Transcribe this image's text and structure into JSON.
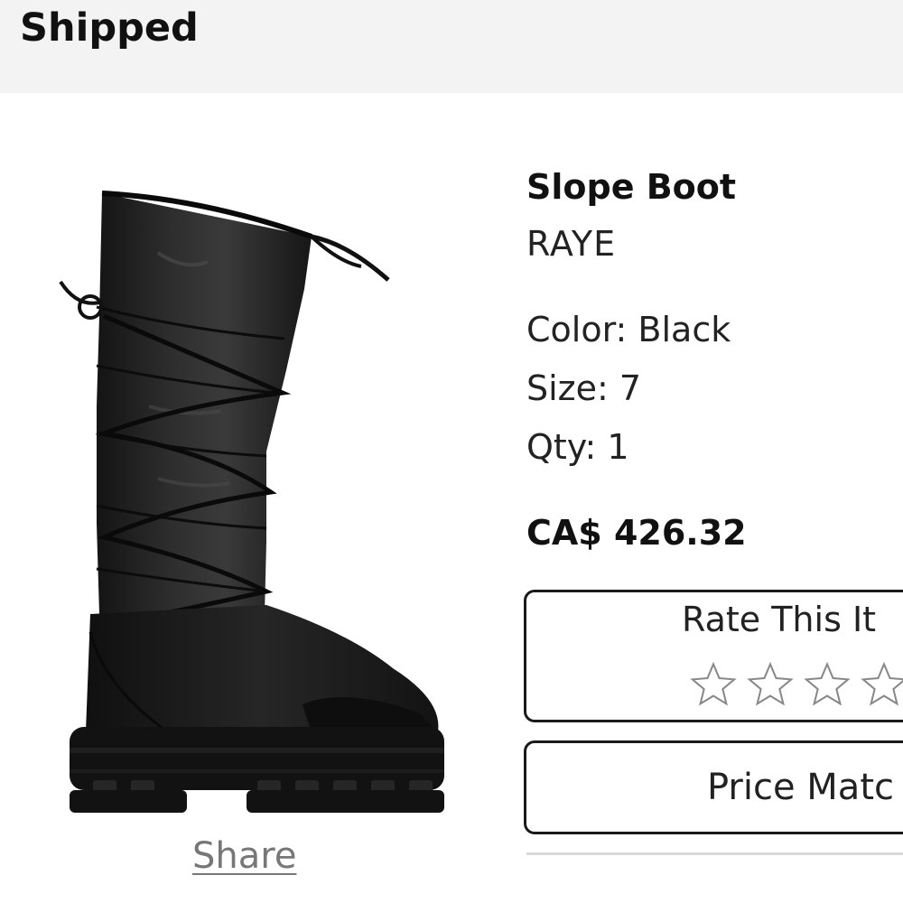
{
  "order": {
    "status": "Shipped"
  },
  "product": {
    "name": "Slope Boot",
    "brand": "RAYE",
    "color_line": "Color: Black",
    "size_line": "Size: 7",
    "qty_line": "Qty: 1",
    "price": "CA$ 426.32",
    "image_icon": "boot-product-photo"
  },
  "actions": {
    "share_label": "Share",
    "rate_title": "Rate This It",
    "rating": {
      "value": 0,
      "max": 5,
      "icon": "star-outline-icon"
    },
    "price_match_label": "Price Matc"
  },
  "colors": {
    "header_bg": "#f3f3f3",
    "share_link": "#777777",
    "border": "#1a1a1a",
    "divider": "#d9d9d9"
  }
}
